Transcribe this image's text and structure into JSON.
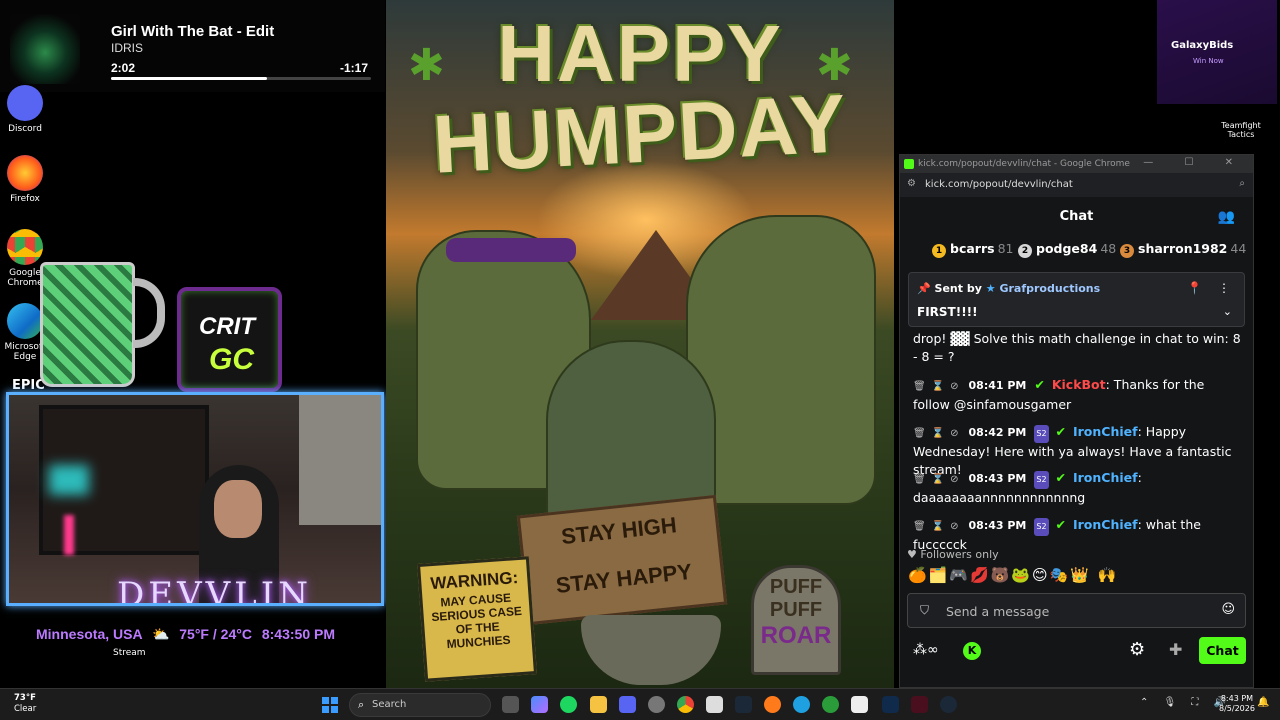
{
  "desktop": {
    "icons": [
      {
        "label": "Discord",
        "color": "#5865f2"
      },
      {
        "label": "Firefox",
        "color": "#ff7a1a"
      },
      {
        "label": "Google Chrome",
        "color": "#1a73e8"
      },
      {
        "label": "Microsoft Edge",
        "color": "#1fa0e0"
      }
    ],
    "epic_label": "EPIC",
    "teamfight_label": "Teamfight Tactics",
    "galaxy": {
      "name": "GalaxyBids",
      "sub": "Win Now"
    }
  },
  "music": {
    "title": "Girl With The Bat - Edit",
    "artist": "IDRIS",
    "elapsed": "2:02",
    "remaining": "-1:17",
    "progress": 0.6
  },
  "crit": {
    "line1": "CRIT",
    "line2": "GC"
  },
  "stream": {
    "name": "DEVVLIN",
    "location": "Minnesota, USA",
    "weather": "75°F / 24°C",
    "time": "8:43:50 PM",
    "label": "Stream"
  },
  "poster": {
    "line1": "HAPPY",
    "line2": "HUMPDAY",
    "stay_line1": "STAY HIGH",
    "stay_line2": "STAY HAPPY",
    "warning_title": "WARNING:",
    "warning_text": "MAY CAUSE SERIOUS CASE OF THE MUNCHIES",
    "puff": "PUFF PUFF",
    "roar": "ROAR"
  },
  "browser": {
    "title": "kick.com/popout/devvlin/chat - Google Chrome",
    "url": "kick.com/popout/devvlin/chat",
    "accent": "#53fc18"
  },
  "chat": {
    "header": "Chat",
    "leaders": [
      {
        "rank": "1",
        "name": "bcarrs",
        "points": "81",
        "color": "#f5b921"
      },
      {
        "rank": "2",
        "name": "podge84",
        "points": "48",
        "color": "#d6d6d6"
      },
      {
        "rank": "3",
        "name": "sharron1982",
        "points": "44",
        "color": "#d98a3d"
      }
    ],
    "pinned": {
      "sent_by": "Sent by",
      "user": "Grafproductions",
      "text": "FIRST!!!!"
    },
    "partial_message": "drop! ▓▓ Solve this math challenge in chat to win: 8 - 8 = ?",
    "messages": [
      {
        "time": "08:41 PM",
        "user": "KickBot",
        "text": ": Thanks for the follow @sinfamousgamer",
        "kind": "bot"
      },
      {
        "time": "08:42 PM",
        "user": "IronChief",
        "text": ": Happy Wednesday! Here with ya always! Have a fantastic stream!",
        "kind": "sub"
      },
      {
        "time": "08:43 PM",
        "user": "IronChief",
        "text": ": daaaaaaaannnnnnnnnnnng",
        "kind": "sub"
      },
      {
        "time": "08:43 PM",
        "user": "IronChief",
        "text": ": what the fuccccck",
        "kind": "sub"
      }
    ],
    "sub_badge": "S2",
    "followers_only": "Followers only",
    "emotes": "🍊🗂️🎮💋🐻🐸😊🎭👑 🙌",
    "input_placeholder": "Send a message",
    "chat_button": "Chat"
  },
  "taskbar": {
    "temp": "73°F",
    "condition": "Clear",
    "search_placeholder": "Search",
    "time": "8:43 PM",
    "date": "8/5/2026"
  }
}
